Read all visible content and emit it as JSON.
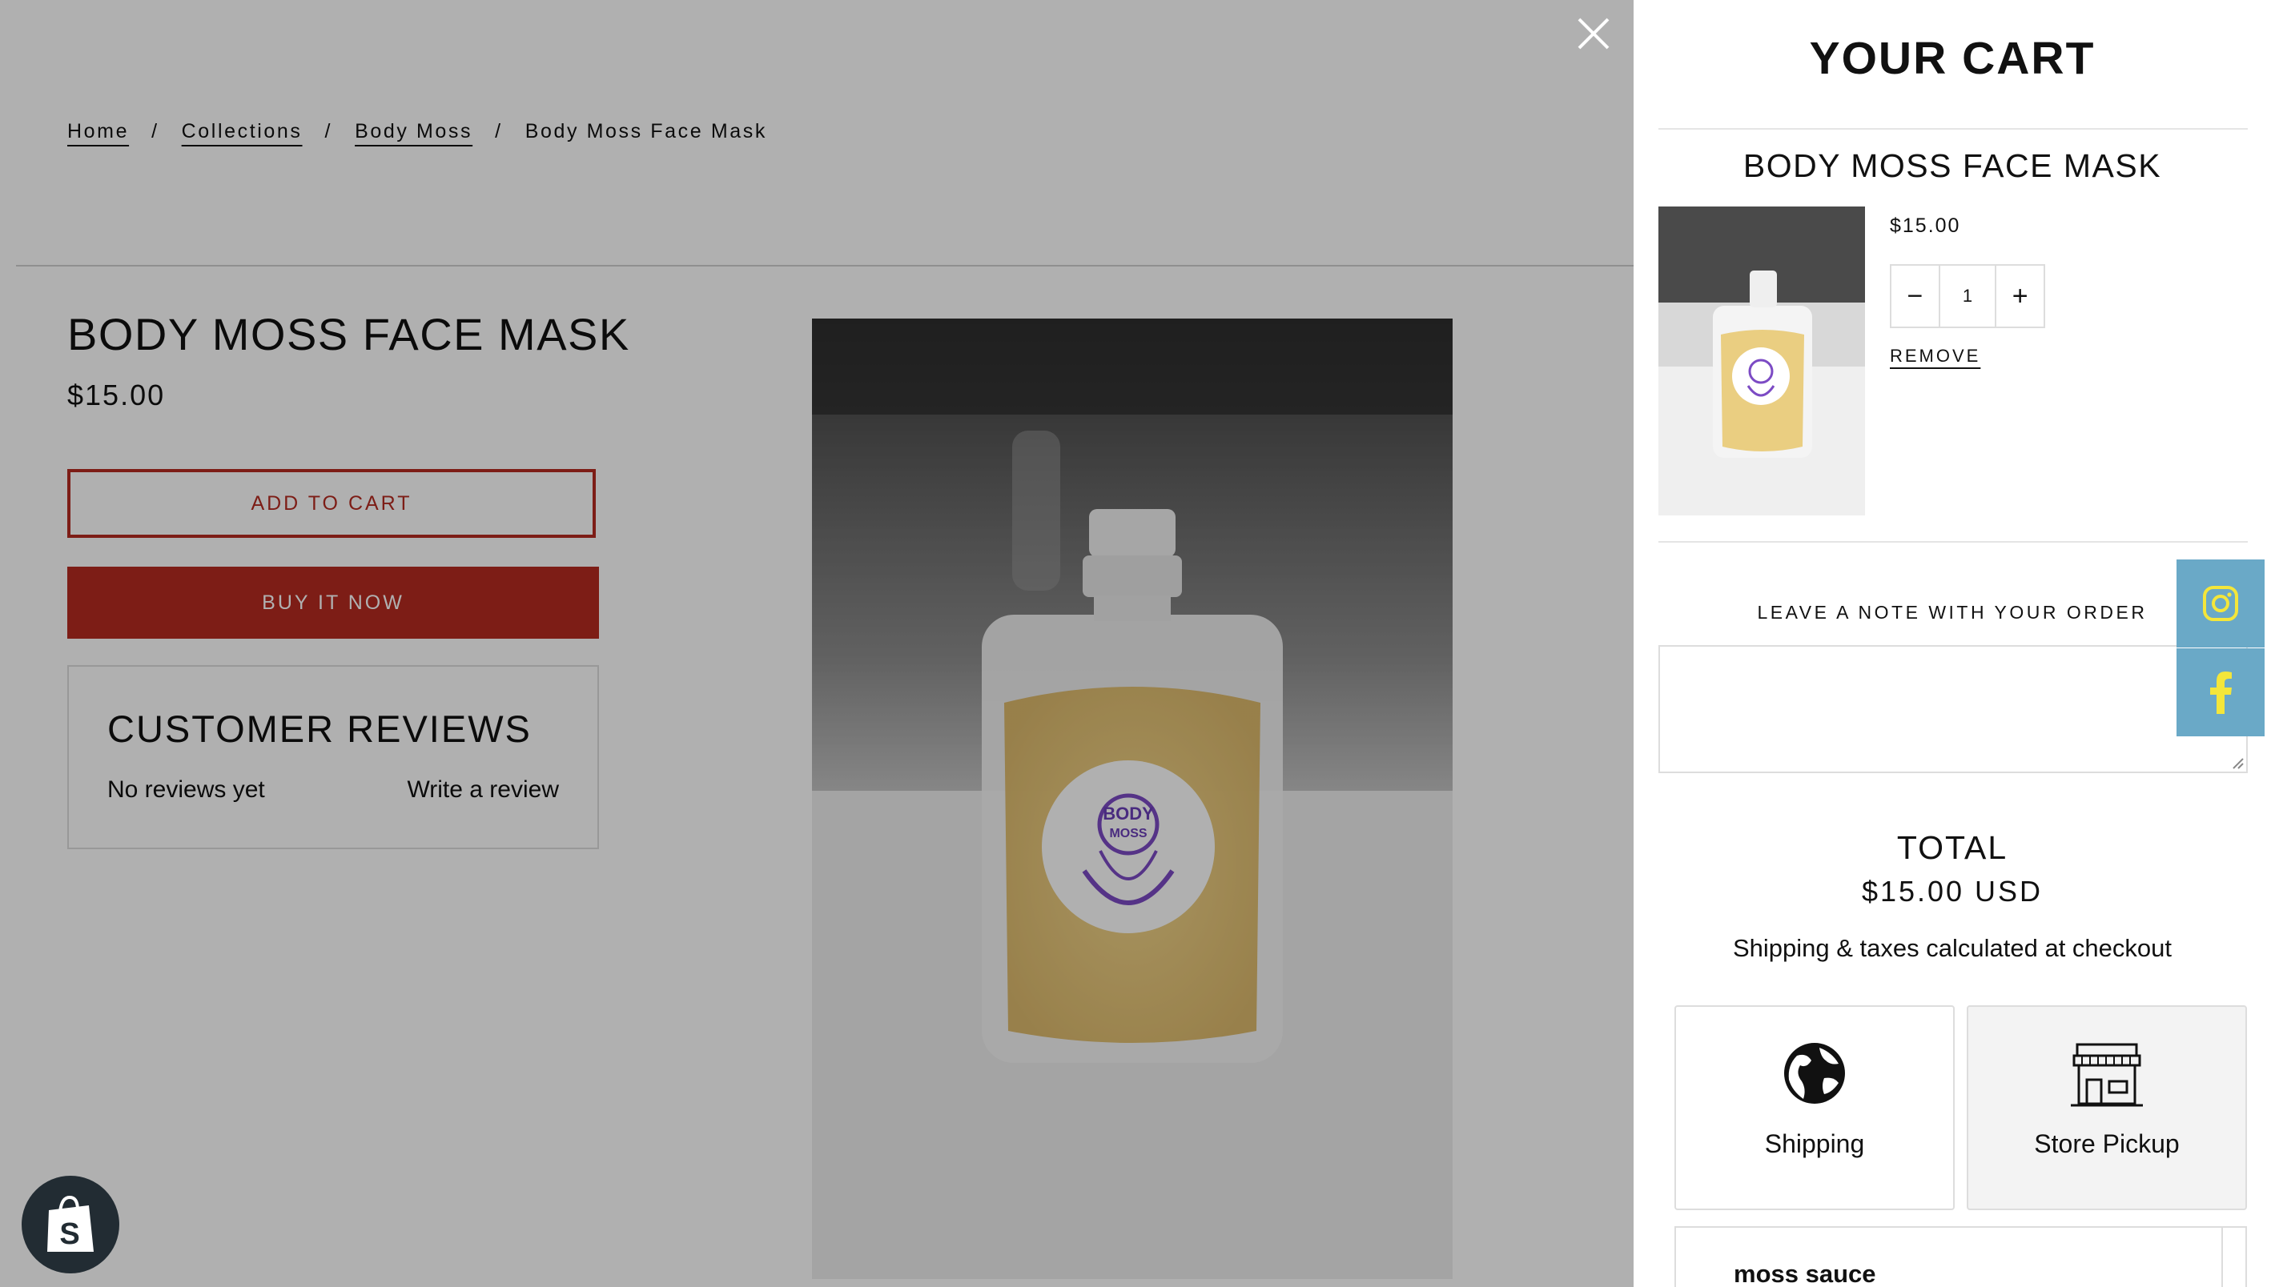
{
  "breadcrumb": {
    "home": "Home",
    "collections": "Collections",
    "body_moss": "Body Moss",
    "current": "Body Moss Face Mask",
    "separator": "/"
  },
  "product": {
    "title": "BODY MOSS FACE MASK",
    "price": "$15.00",
    "add_to_cart": "ADD TO CART",
    "buy_now": "BUY IT NOW",
    "image_label_line1": "BODY",
    "image_label_line2": "MOSS"
  },
  "reviews": {
    "heading": "CUSTOMER REVIEWS",
    "empty": "No reviews yet",
    "write": "Write a review"
  },
  "cart": {
    "title": "YOUR CART",
    "item_name": "BODY MOSS FACE MASK",
    "item_price": "$15.00",
    "quantity": "1",
    "minus": "−",
    "plus": "+",
    "remove": "REMOVE",
    "note_label": "LEAVE A NOTE WITH YOUR ORDER",
    "total_label": "TOTAL",
    "total_value": "$15.00 USD",
    "shipping_note": "Shipping & taxes calculated at checkout",
    "delivery_options": [
      {
        "label": "Shipping",
        "icon": "globe-icon"
      },
      {
        "label": "Store Pickup",
        "icon": "storefront-icon"
      }
    ],
    "pickup_location": "moss sauce"
  },
  "social": [
    {
      "name": "instagram-icon"
    },
    {
      "name": "facebook-icon"
    }
  ],
  "colors": {
    "accent": "#b52a20",
    "overlay": "#aaaaaa",
    "social_bg": "#6aa9c7",
    "social_icon": "#f4e63a",
    "shop_badge": "#222c33"
  }
}
